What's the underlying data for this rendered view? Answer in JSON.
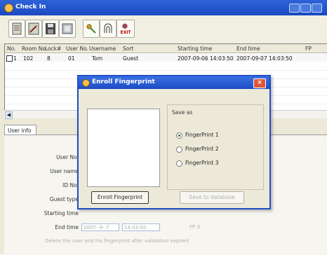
{
  "window": {
    "title": "Check In"
  },
  "toolbar": {
    "exit_label": "EXIT"
  },
  "grid": {
    "columns": [
      "No.",
      "Room No.",
      "Lock#",
      "User No.",
      "Username",
      "Sort",
      "Starting time",
      "End time",
      "FP"
    ],
    "rows": [
      {
        "no": "1",
        "room": "102",
        "lock": "8",
        "user_no": "01",
        "username": "Tom",
        "sort": "Guest",
        "start": "2007-09-06 14:03:50",
        "end": "2007-09-07 14:03:50"
      }
    ]
  },
  "tabs": {
    "user_info": "User info"
  },
  "form": {
    "user_no": "User No.",
    "user_name": "User name",
    "id_no": "ID No.",
    "guest_type": "Guest type",
    "starting_time": "Starting time",
    "end_time": "End time",
    "end_date_value": "2007- 9- 7",
    "end_time_value": "14:03:50",
    "fp_label": "FP 3",
    "delete_note": "Delete the user and his fingerprint after validation expired"
  },
  "dialog": {
    "title": "Enroll Fingerprint",
    "save_as": "Save as",
    "options": [
      "FingerPrint 1",
      "FingerPrint 2",
      "FingerPrint 3"
    ],
    "selected_option": "FingerPrint 1",
    "enroll_button": "Enroll Fingerprint",
    "save_button": "Save to database"
  }
}
